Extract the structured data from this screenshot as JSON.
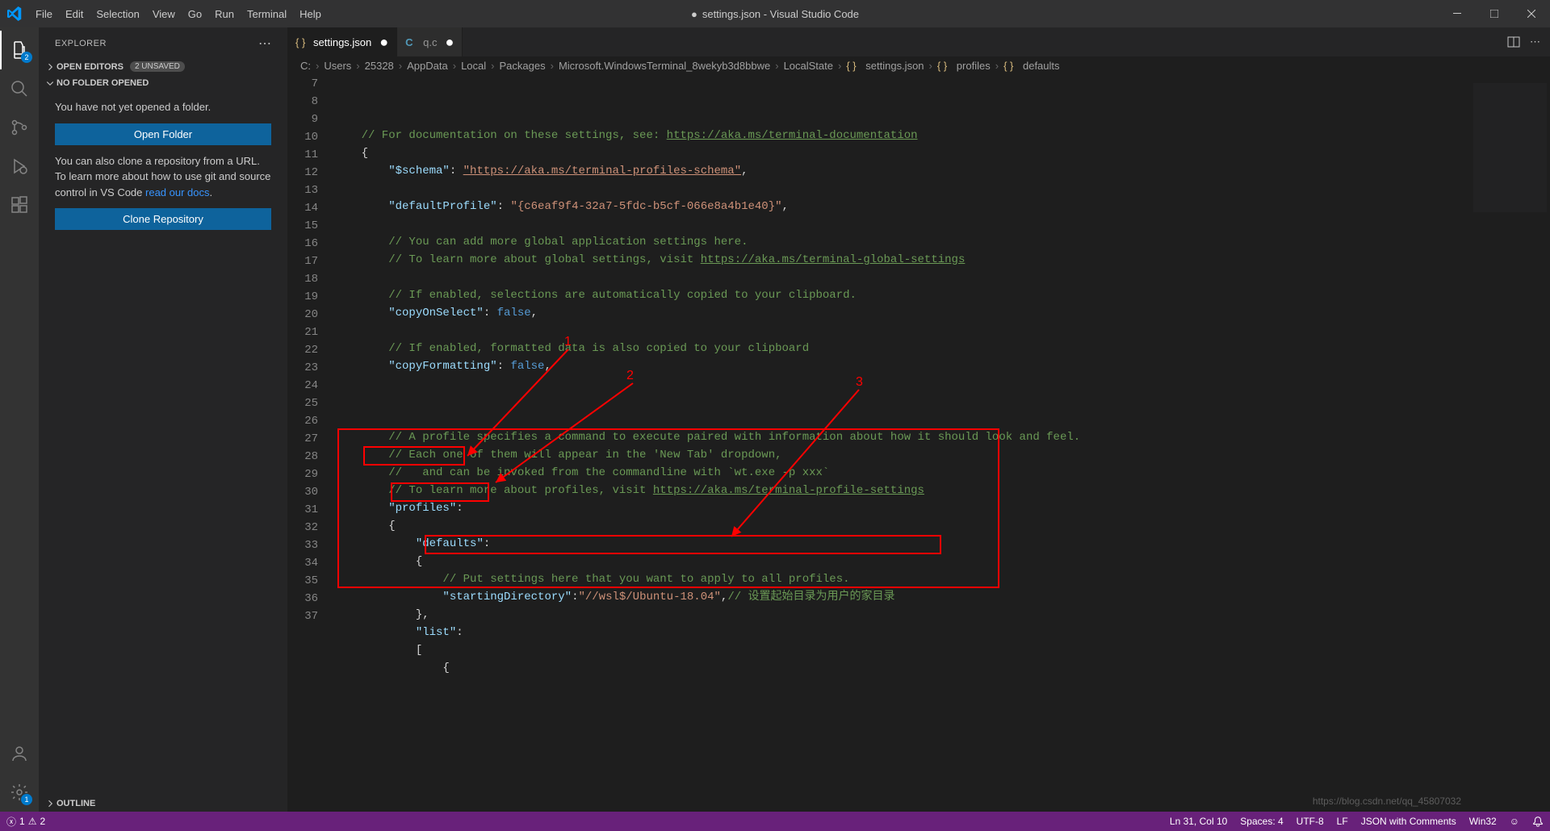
{
  "title": {
    "dirty_indicator": "●",
    "filename": "settings.json",
    "app": "Visual Studio Code"
  },
  "menu": [
    "File",
    "Edit",
    "Selection",
    "View",
    "Go",
    "Run",
    "Terminal",
    "Help"
  ],
  "activity": {
    "explorer_badge": "2",
    "settings_badge": "1"
  },
  "sidebar": {
    "title": "EXPLORER",
    "open_editors": {
      "label": "OPEN EDITORS",
      "unsaved": "2 UNSAVED"
    },
    "no_folder": {
      "label": "NO FOLDER OPENED",
      "msg1": "You have not yet opened a folder.",
      "btn_open": "Open Folder",
      "msg2_a": "You can also clone a repository from a URL. To learn more about how to use git and source control in VS Code ",
      "msg2_link": "read our docs",
      "msg2_b": ".",
      "btn_clone": "Clone Repository"
    },
    "outline": "OUTLINE"
  },
  "tabs": [
    {
      "label": "settings.json",
      "icon": "braces",
      "dirty": true,
      "active": true
    },
    {
      "label": "q.c",
      "icon": "c-file",
      "dirty": true,
      "active": false
    }
  ],
  "breadcrumbs": [
    "C:",
    "Users",
    "25328",
    "AppData",
    "Local",
    "Packages",
    "Microsoft.WindowsTerminal_8wekyb3d8bbwe",
    "LocalState",
    "settings.json",
    "profiles",
    "defaults"
  ],
  "code_lines": [
    {
      "n": 7,
      "segs": [
        [
          "c-comment",
          "    // For documentation on these settings, see: "
        ],
        [
          "c-link-comment",
          "https://aka.ms/terminal-documentation"
        ]
      ]
    },
    {
      "n": 8,
      "segs": [
        [
          "c-punc",
          "    {"
        ]
      ]
    },
    {
      "n": 9,
      "segs": [
        [
          "c-punc",
          "        "
        ],
        [
          "c-key",
          "\"$schema\""
        ],
        [
          "c-punc",
          ": "
        ],
        [
          "c-link",
          "\"https://aka.ms/terminal-profiles-schema\""
        ],
        [
          "c-punc",
          ","
        ]
      ]
    },
    {
      "n": 10,
      "segs": [
        [
          "c-punc",
          ""
        ]
      ]
    },
    {
      "n": 11,
      "segs": [
        [
          "c-punc",
          "        "
        ],
        [
          "c-key",
          "\"defaultProfile\""
        ],
        [
          "c-punc",
          ": "
        ],
        [
          "c-str",
          "\"{c6eaf9f4-32a7-5fdc-b5cf-066e8a4b1e40}\""
        ],
        [
          "c-punc",
          ","
        ]
      ]
    },
    {
      "n": 12,
      "segs": [
        [
          "c-punc",
          ""
        ]
      ]
    },
    {
      "n": 13,
      "segs": [
        [
          "c-comment",
          "        // You can add more global application settings here."
        ]
      ]
    },
    {
      "n": 14,
      "segs": [
        [
          "c-comment",
          "        // To learn more about global settings, visit "
        ],
        [
          "c-link-comment",
          "https://aka.ms/terminal-global-settings"
        ]
      ]
    },
    {
      "n": 15,
      "segs": [
        [
          "c-punc",
          ""
        ]
      ]
    },
    {
      "n": 16,
      "segs": [
        [
          "c-comment",
          "        // If enabled, selections are automatically copied to your clipboard."
        ]
      ]
    },
    {
      "n": 17,
      "segs": [
        [
          "c-punc",
          "        "
        ],
        [
          "c-key",
          "\"copyOnSelect\""
        ],
        [
          "c-punc",
          ": "
        ],
        [
          "c-bool",
          "false"
        ],
        [
          "c-punc",
          ","
        ]
      ]
    },
    {
      "n": 18,
      "segs": [
        [
          "c-punc",
          ""
        ]
      ]
    },
    {
      "n": 19,
      "segs": [
        [
          "c-comment",
          "        // If enabled, formatted data is also copied to your clipboard"
        ]
      ]
    },
    {
      "n": 20,
      "segs": [
        [
          "c-punc",
          "        "
        ],
        [
          "c-key",
          "\"copyFormatting\""
        ],
        [
          "c-punc",
          ": "
        ],
        [
          "c-bool",
          "false"
        ],
        [
          "c-punc",
          ","
        ]
      ]
    },
    {
      "n": 21,
      "segs": [
        [
          "c-punc",
          ""
        ]
      ]
    },
    {
      "n": 22,
      "segs": [
        [
          "c-punc",
          ""
        ]
      ]
    },
    {
      "n": 23,
      "segs": [
        [
          "c-punc",
          ""
        ]
      ]
    },
    {
      "n": 24,
      "segs": [
        [
          "c-comment",
          "        // A profile specifies a command to execute paired with information about how it should look and feel."
        ]
      ]
    },
    {
      "n": 25,
      "segs": [
        [
          "c-comment",
          "        // Each one of them will appear in the 'New Tab' dropdown,"
        ]
      ]
    },
    {
      "n": 26,
      "segs": [
        [
          "c-comment",
          "        //   and can be invoked from the commandline with `wt.exe -p xxx`"
        ]
      ]
    },
    {
      "n": 27,
      "segs": [
        [
          "c-comment",
          "        // To learn more about profiles, visit "
        ],
        [
          "c-link-comment",
          "https://aka.ms/terminal-profile-settings"
        ]
      ]
    },
    {
      "n": 28,
      "segs": [
        [
          "c-punc",
          "        "
        ],
        [
          "c-key",
          "\"profiles\""
        ],
        [
          "c-punc",
          ":"
        ]
      ]
    },
    {
      "n": 29,
      "segs": [
        [
          "c-punc",
          "        {"
        ]
      ]
    },
    {
      "n": 30,
      "segs": [
        [
          "c-punc",
          "            "
        ],
        [
          "c-key",
          "\"defaults\""
        ],
        [
          "c-punc",
          ":"
        ]
      ]
    },
    {
      "n": 31,
      "segs": [
        [
          "c-punc",
          "            {"
        ]
      ]
    },
    {
      "n": 32,
      "segs": [
        [
          "c-comment",
          "                // Put settings here that you want to apply to all profiles."
        ]
      ]
    },
    {
      "n": 33,
      "segs": [
        [
          "c-punc",
          "                "
        ],
        [
          "c-key",
          "\"startingDirectory\""
        ],
        [
          "c-punc",
          ":"
        ],
        [
          "c-str",
          "\"//wsl$/Ubuntu-18.04\""
        ],
        [
          "c-punc",
          ","
        ],
        [
          "c-cn-comment",
          "// 设置起始目录为用户的家目录"
        ]
      ]
    },
    {
      "n": 34,
      "segs": [
        [
          "c-punc",
          "            },"
        ]
      ]
    },
    {
      "n": 35,
      "segs": [
        [
          "c-punc",
          "            "
        ],
        [
          "c-key",
          "\"list\""
        ],
        [
          "c-punc",
          ":"
        ]
      ]
    },
    {
      "n": 36,
      "segs": [
        [
          "c-punc",
          "            ["
        ]
      ]
    },
    {
      "n": 37,
      "segs": [
        [
          "c-punc",
          "                {"
        ]
      ]
    }
  ],
  "annotations": {
    "num1": "1",
    "num2": "2",
    "num3": "3"
  },
  "status": {
    "errors": "1",
    "warnings": "2",
    "ln_col": "Ln 31, Col 10",
    "spaces": "Spaces: 4",
    "encoding": "UTF-8",
    "eol": "LF",
    "lang": "JSON with Comments",
    "os": "Win32",
    "feedback": "☺"
  },
  "watermark": "https://blog.csdn.net/qq_45807032"
}
